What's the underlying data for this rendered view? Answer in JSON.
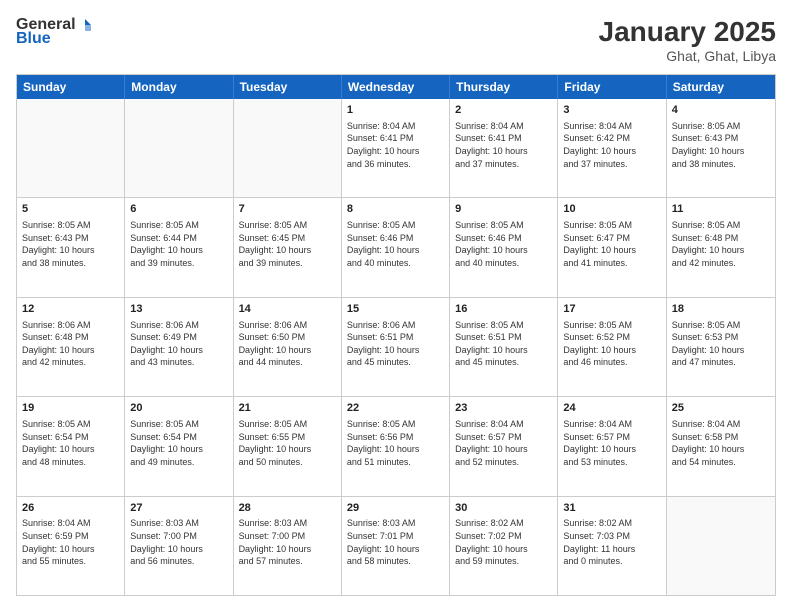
{
  "header": {
    "logo": {
      "general": "General",
      "blue": "Blue"
    },
    "title": "January 2025",
    "location": "Ghat, Ghat, Libya"
  },
  "dayHeaders": [
    "Sunday",
    "Monday",
    "Tuesday",
    "Wednesday",
    "Thursday",
    "Friday",
    "Saturday"
  ],
  "weeks": [
    [
      {
        "date": "",
        "info": ""
      },
      {
        "date": "",
        "info": ""
      },
      {
        "date": "",
        "info": ""
      },
      {
        "date": "1",
        "info": "Sunrise: 8:04 AM\nSunset: 6:41 PM\nDaylight: 10 hours\nand 36 minutes."
      },
      {
        "date": "2",
        "info": "Sunrise: 8:04 AM\nSunset: 6:41 PM\nDaylight: 10 hours\nand 37 minutes."
      },
      {
        "date": "3",
        "info": "Sunrise: 8:04 AM\nSunset: 6:42 PM\nDaylight: 10 hours\nand 37 minutes."
      },
      {
        "date": "4",
        "info": "Sunrise: 8:05 AM\nSunset: 6:43 PM\nDaylight: 10 hours\nand 38 minutes."
      }
    ],
    [
      {
        "date": "5",
        "info": "Sunrise: 8:05 AM\nSunset: 6:43 PM\nDaylight: 10 hours\nand 38 minutes."
      },
      {
        "date": "6",
        "info": "Sunrise: 8:05 AM\nSunset: 6:44 PM\nDaylight: 10 hours\nand 39 minutes."
      },
      {
        "date": "7",
        "info": "Sunrise: 8:05 AM\nSunset: 6:45 PM\nDaylight: 10 hours\nand 39 minutes."
      },
      {
        "date": "8",
        "info": "Sunrise: 8:05 AM\nSunset: 6:46 PM\nDaylight: 10 hours\nand 40 minutes."
      },
      {
        "date": "9",
        "info": "Sunrise: 8:05 AM\nSunset: 6:46 PM\nDaylight: 10 hours\nand 40 minutes."
      },
      {
        "date": "10",
        "info": "Sunrise: 8:05 AM\nSunset: 6:47 PM\nDaylight: 10 hours\nand 41 minutes."
      },
      {
        "date": "11",
        "info": "Sunrise: 8:05 AM\nSunset: 6:48 PM\nDaylight: 10 hours\nand 42 minutes."
      }
    ],
    [
      {
        "date": "12",
        "info": "Sunrise: 8:06 AM\nSunset: 6:48 PM\nDaylight: 10 hours\nand 42 minutes."
      },
      {
        "date": "13",
        "info": "Sunrise: 8:06 AM\nSunset: 6:49 PM\nDaylight: 10 hours\nand 43 minutes."
      },
      {
        "date": "14",
        "info": "Sunrise: 8:06 AM\nSunset: 6:50 PM\nDaylight: 10 hours\nand 44 minutes."
      },
      {
        "date": "15",
        "info": "Sunrise: 8:06 AM\nSunset: 6:51 PM\nDaylight: 10 hours\nand 45 minutes."
      },
      {
        "date": "16",
        "info": "Sunrise: 8:05 AM\nSunset: 6:51 PM\nDaylight: 10 hours\nand 45 minutes."
      },
      {
        "date": "17",
        "info": "Sunrise: 8:05 AM\nSunset: 6:52 PM\nDaylight: 10 hours\nand 46 minutes."
      },
      {
        "date": "18",
        "info": "Sunrise: 8:05 AM\nSunset: 6:53 PM\nDaylight: 10 hours\nand 47 minutes."
      }
    ],
    [
      {
        "date": "19",
        "info": "Sunrise: 8:05 AM\nSunset: 6:54 PM\nDaylight: 10 hours\nand 48 minutes."
      },
      {
        "date": "20",
        "info": "Sunrise: 8:05 AM\nSunset: 6:54 PM\nDaylight: 10 hours\nand 49 minutes."
      },
      {
        "date": "21",
        "info": "Sunrise: 8:05 AM\nSunset: 6:55 PM\nDaylight: 10 hours\nand 50 minutes."
      },
      {
        "date": "22",
        "info": "Sunrise: 8:05 AM\nSunset: 6:56 PM\nDaylight: 10 hours\nand 51 minutes."
      },
      {
        "date": "23",
        "info": "Sunrise: 8:04 AM\nSunset: 6:57 PM\nDaylight: 10 hours\nand 52 minutes."
      },
      {
        "date": "24",
        "info": "Sunrise: 8:04 AM\nSunset: 6:57 PM\nDaylight: 10 hours\nand 53 minutes."
      },
      {
        "date": "25",
        "info": "Sunrise: 8:04 AM\nSunset: 6:58 PM\nDaylight: 10 hours\nand 54 minutes."
      }
    ],
    [
      {
        "date": "26",
        "info": "Sunrise: 8:04 AM\nSunset: 6:59 PM\nDaylight: 10 hours\nand 55 minutes."
      },
      {
        "date": "27",
        "info": "Sunrise: 8:03 AM\nSunset: 7:00 PM\nDaylight: 10 hours\nand 56 minutes."
      },
      {
        "date": "28",
        "info": "Sunrise: 8:03 AM\nSunset: 7:00 PM\nDaylight: 10 hours\nand 57 minutes."
      },
      {
        "date": "29",
        "info": "Sunrise: 8:03 AM\nSunset: 7:01 PM\nDaylight: 10 hours\nand 58 minutes."
      },
      {
        "date": "30",
        "info": "Sunrise: 8:02 AM\nSunset: 7:02 PM\nDaylight: 10 hours\nand 59 minutes."
      },
      {
        "date": "31",
        "info": "Sunrise: 8:02 AM\nSunset: 7:03 PM\nDaylight: 11 hours\nand 0 minutes."
      },
      {
        "date": "",
        "info": ""
      }
    ]
  ]
}
